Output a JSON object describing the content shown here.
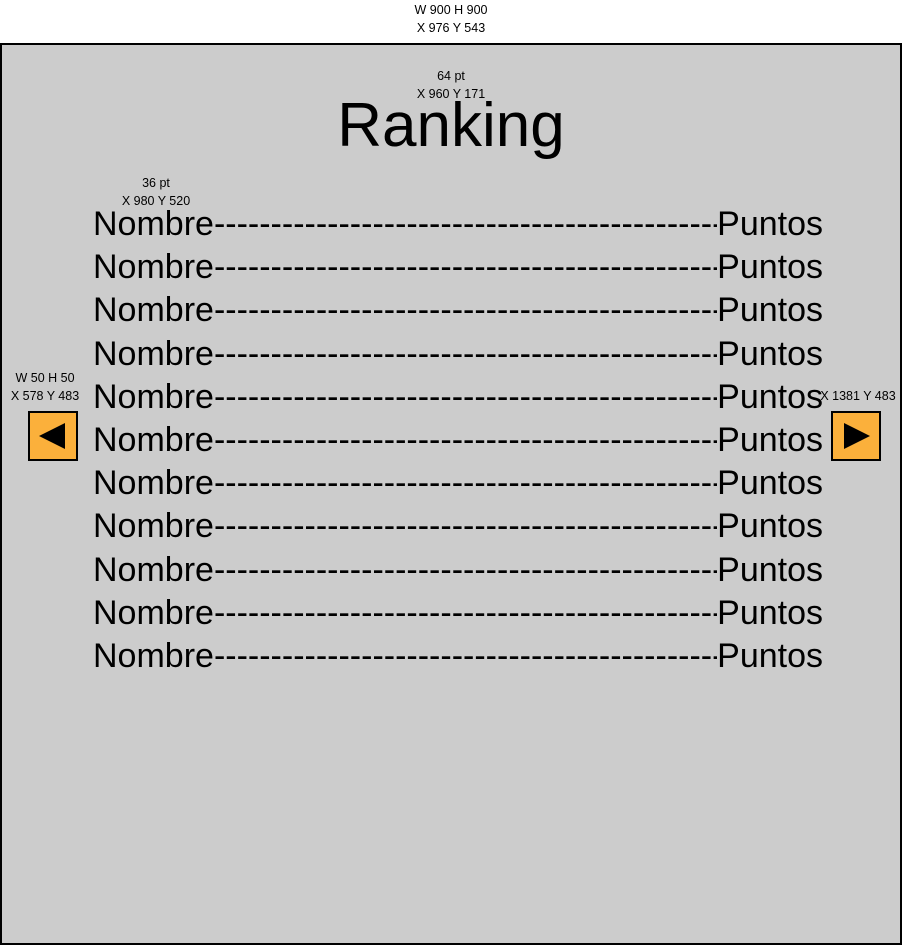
{
  "annotations": {
    "frame_size": "W 900 H 900",
    "frame_pos": "X 976 Y 543",
    "title_size": "64 pt",
    "title_pos": "X 960 Y 171",
    "row_size": "36 pt",
    "row_pos": "X 980 Y 520",
    "button_size": "W 50 H 50",
    "left_button_pos": "X 578 Y 483",
    "right_button_pos": "X 1381 Y 483"
  },
  "title": "Ranking",
  "rows": [
    {
      "name": "Nombre",
      "dashes": "-----------------------------------------------------",
      "points": "Puntos"
    },
    {
      "name": "Nombre",
      "dashes": "-----------------------------------------------------",
      "points": "Puntos"
    },
    {
      "name": "Nombre",
      "dashes": "-----------------------------------------------------",
      "points": "Puntos"
    },
    {
      "name": "Nombre",
      "dashes": "-----------------------------------------------------",
      "points": "Puntos"
    },
    {
      "name": "Nombre",
      "dashes": "-----------------------------------------------------",
      "points": "Puntos"
    },
    {
      "name": "Nombre",
      "dashes": "-----------------------------------------------------",
      "points": "Puntos"
    },
    {
      "name": "Nombre",
      "dashes": "-----------------------------------------------------",
      "points": "Puntos"
    },
    {
      "name": "Nombre",
      "dashes": "-----------------------------------------------------",
      "points": "Puntos"
    },
    {
      "name": "Nombre",
      "dashes": "-----------------------------------------------------",
      "points": "Puntos"
    },
    {
      "name": "Nombre",
      "dashes": "-----------------------------------------------------",
      "points": "Puntos"
    },
    {
      "name": "Nombre",
      "dashes": "-----------------------------------------------------",
      "points": "Puntos"
    }
  ],
  "colors": {
    "frame_bg": "#cccccc",
    "button_bg": "#fbb03b"
  },
  "icons": {
    "prev": "triangle-left-icon",
    "next": "triangle-right-icon"
  }
}
